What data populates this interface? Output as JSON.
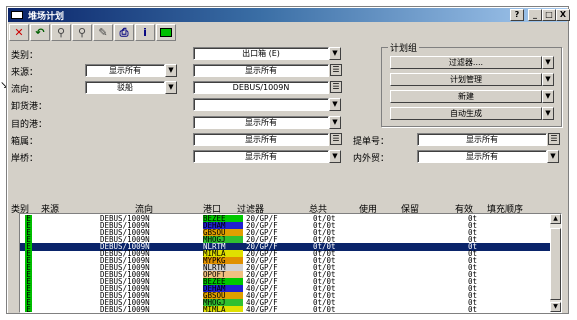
{
  "window": {
    "title": "堆场计划",
    "help_label": "?",
    "minimize_label": "_",
    "maximize_label": "□",
    "close_label": "X"
  },
  "toolbar": {
    "tools": [
      {
        "name": "delete-tool",
        "glyph": "✕",
        "color": "#cc0000"
      },
      {
        "name": "undo-tool",
        "glyph": "↶",
        "color": "#006000"
      },
      {
        "name": "pin-tool",
        "glyph": "⚲",
        "color": "#444444"
      },
      {
        "name": "find-tool",
        "glyph": "⚲",
        "color": "#444444"
      },
      {
        "name": "edit-tool",
        "glyph": "✎",
        "color": "#444444"
      },
      {
        "name": "print-tool",
        "glyph": "⎙",
        "color": "#000080"
      },
      {
        "name": "info-tool",
        "glyph": "i",
        "color": "#000080"
      },
      {
        "name": "status-tool",
        "glyph": "",
        "color": "#00c000"
      }
    ]
  },
  "form": {
    "category_label": "类别：",
    "category_value": "出口箱 (E)",
    "source_label": "来源：",
    "source_value": "显示所有",
    "source_value2": "显示所有",
    "direction_label": "流向：",
    "direction_value": "驳船",
    "direction_value2": "DEBUS/1009N",
    "discharge_label": "卸货港：",
    "discharge_value": "",
    "destination_label": "目的港：",
    "destination_value": "显示所有",
    "boxtype_label": "箱属：",
    "boxtype_value": "显示所有",
    "bill_label": "提单号：",
    "bill_value": "显示所有",
    "berth_label": "岸桥：",
    "berth_value": "显示所有",
    "trade_label": "内外贸：",
    "trade_value": "显示所有"
  },
  "plan_group": {
    "title": "计划组",
    "filter_label": "过滤器....",
    "manage_label": "计划管理",
    "new_label": "新建",
    "auto_label": "自动生成"
  },
  "table": {
    "headers": [
      "类别",
      "来源",
      "流向",
      "港口",
      "过滤器",
      "总共",
      "使用",
      "保留",
      "有效",
      "填充顺序"
    ],
    "rows": [
      {
        "kind": "E",
        "flow": "DEBUS/1009N",
        "port": "BEZEE",
        "port_color": "#00c800",
        "filter": "20/GP/F",
        "total": "0t/0t",
        "valid": "0t",
        "selected": false
      },
      {
        "kind": "E",
        "flow": "DEBUS/1009N",
        "port": "DEHAM",
        "port_color": "#2020d0",
        "filter": "20/GP/F",
        "total": "0t/0t",
        "valid": "0t",
        "selected": false
      },
      {
        "kind": "E",
        "flow": "DEBUS/1009N",
        "port": "GBSOU",
        "port_color": "#e0a000",
        "filter": "20/GP/F",
        "total": "0t/0t",
        "valid": "0t",
        "selected": false
      },
      {
        "kind": "E",
        "flow": "DEBUS/1009N",
        "port": "MHOGJ",
        "port_color": "#30c030",
        "filter": "20/GP/F",
        "total": "0t/0t",
        "valid": "0t",
        "selected": false
      },
      {
        "kind": "E",
        "flow": "DEBUS/1009N",
        "port": "NLRTM",
        "port_color": "#0a246a",
        "filter": "20/GP/F",
        "total": "0t/0t",
        "valid": "0t",
        "selected": true
      },
      {
        "kind": "E",
        "flow": "DEBUS/1009N",
        "port": "MIMLA",
        "port_color": "#e0e000",
        "filter": "20/GP/F",
        "total": "0t/0t",
        "valid": "0t",
        "selected": false
      },
      {
        "kind": "E",
        "flow": "DEBUS/1009N",
        "port": "MYPKG",
        "port_color": "#e09000",
        "filter": "20/GP/F",
        "total": "0t/0t",
        "valid": "0t",
        "selected": false
      },
      {
        "kind": "E",
        "flow": "DEBUS/1009N",
        "port": "NLRTM",
        "port_color": "#d0d0d0",
        "filter": "20/GP/F",
        "total": "0t/0t",
        "valid": "0t",
        "selected": false
      },
      {
        "kind": "E",
        "flow": "DEBUS/1009N",
        "port": "OPOFT",
        "port_color": "#f0c080",
        "filter": "20/GP/F",
        "total": "0t/0t",
        "valid": "0t",
        "selected": false
      },
      {
        "kind": "E",
        "flow": "DEBUS/1009N",
        "port": "BEZEE",
        "port_color": "#00c800",
        "filter": "40/GP/F",
        "total": "0t/0t",
        "valid": "0t",
        "selected": false
      },
      {
        "kind": "E",
        "flow": "DEBUS/1009N",
        "port": "DEHAM",
        "port_color": "#2020d0",
        "filter": "40/GP/F",
        "total": "0t/0t",
        "valid": "0t",
        "selected": false
      },
      {
        "kind": "E",
        "flow": "DEBUS/1009N",
        "port": "GBSOU",
        "port_color": "#e0a000",
        "filter": "40/GP/F",
        "total": "0t/0t",
        "valid": "0t",
        "selected": false
      },
      {
        "kind": "E",
        "flow": "DEBUS/1009N",
        "port": "MHOGJ",
        "port_color": "#30c030",
        "filter": "40/GP/F",
        "total": "0t/0t",
        "valid": "0t",
        "selected": false
      },
      {
        "kind": "E",
        "flow": "DEBUS/1009N",
        "port": "MIMLA",
        "port_color": "#e0e000",
        "filter": "40/GP/F",
        "total": "0t/0t",
        "valid": "0t",
        "selected": false
      }
    ]
  },
  "colors": {
    "selection": "#0a246a",
    "kind_badge": "#00c000"
  }
}
